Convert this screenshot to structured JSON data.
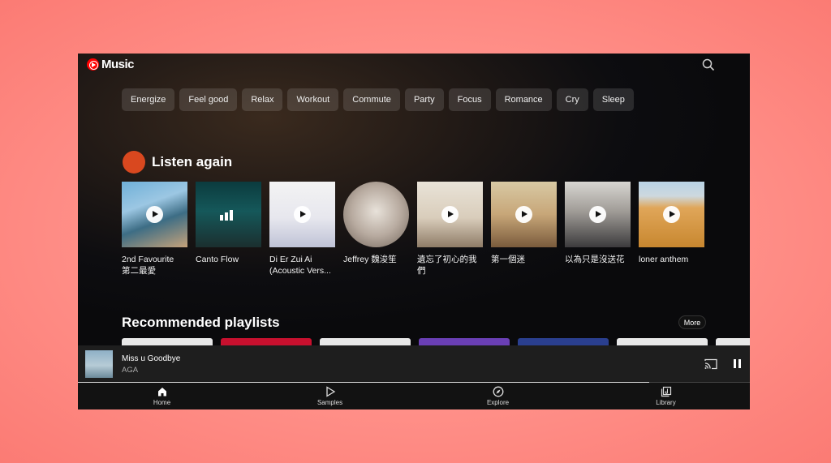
{
  "app": {
    "title": "Music",
    "logo_icon": "youtube-music-logo-icon",
    "accent": "#ff0000"
  },
  "header": {
    "search_icon": "search-icon"
  },
  "moods": [
    "Energize",
    "Feel good",
    "Relax",
    "Workout",
    "Commute",
    "Party",
    "Focus",
    "Romance",
    "Cry",
    "Sleep"
  ],
  "listen_again": {
    "title": "Listen again",
    "items": [
      {
        "title": "2nd Favourite",
        "subtitle": "第二最愛"
      },
      {
        "title": "Canto Flow",
        "subtitle": ""
      },
      {
        "title": "Di Er Zui Ai",
        "subtitle": "(Acoustic Vers..."
      },
      {
        "title": "Jeffrey 魏浚笙",
        "subtitle": ""
      },
      {
        "title": "遺忘了初心的我",
        "subtitle": "們"
      },
      {
        "title": "第一個迷",
        "subtitle": ""
      },
      {
        "title": "以為只是沒送花",
        "subtitle": ""
      },
      {
        "title": "loner anthem",
        "subtitle": ""
      }
    ]
  },
  "recommended": {
    "title": "Recommended playlists",
    "more_label": "More"
  },
  "now_playing": {
    "title": "Miss u Goodbye",
    "artist": "AGA",
    "progress": 0.85
  },
  "bottom_nav": [
    {
      "label": "Home",
      "icon": "home-icon"
    },
    {
      "label": "Samples",
      "icon": "samples-icon"
    },
    {
      "label": "Explore",
      "icon": "explore-icon"
    },
    {
      "label": "Library",
      "icon": "library-icon"
    }
  ]
}
